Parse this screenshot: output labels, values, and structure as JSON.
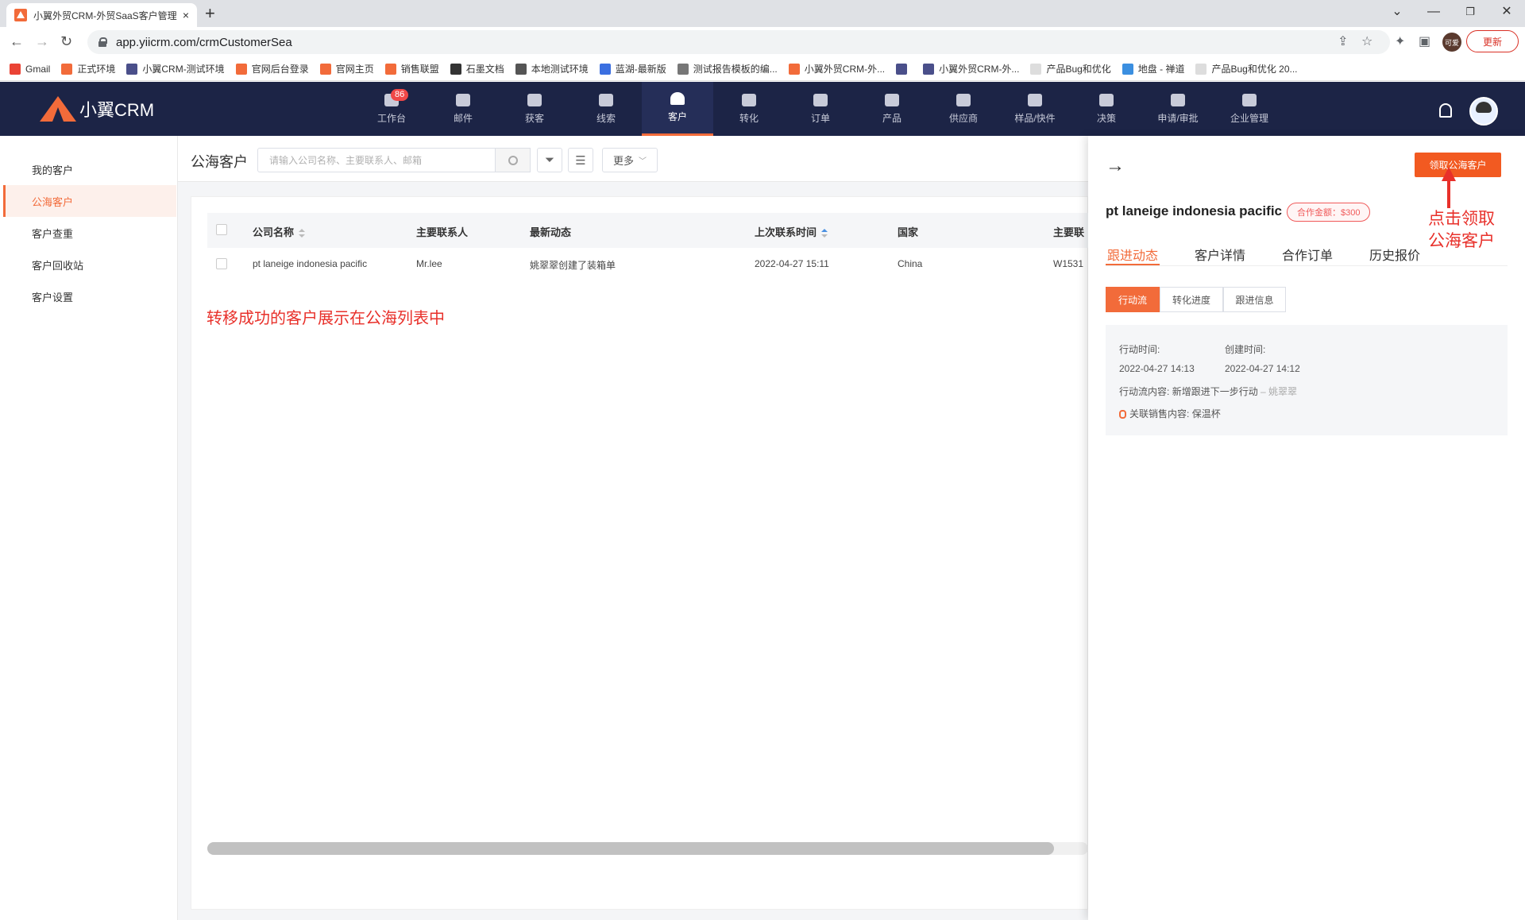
{
  "browser": {
    "tab_title": "小翼外贸CRM-外贸SaaS客户管理",
    "url": "app.yiicrm.com/crmCustomerSea",
    "update_label": "更新",
    "profile_label": "可爱",
    "bookmarks": [
      {
        "label": "Gmail",
        "color": "#ea4335"
      },
      {
        "label": "正式环境",
        "color": "#f26b3a"
      },
      {
        "label": "小翼CRM-测试环境",
        "color": "#4a4f8a"
      },
      {
        "label": "官网后台登录",
        "color": "#f26b3a"
      },
      {
        "label": "官网主页",
        "color": "#f26b3a"
      },
      {
        "label": "销售联盟",
        "color": "#f26b3a"
      },
      {
        "label": "石墨文档",
        "color": "#333333"
      },
      {
        "label": "本地测试环境",
        "color": "#555555"
      },
      {
        "label": "蓝湖-最新版",
        "color": "#3b6fe0"
      },
      {
        "label": "测试报告模板的编...",
        "color": "#777777"
      },
      {
        "label": "小翼外贸CRM-外...",
        "color": "#f26b3a"
      },
      {
        "label": "",
        "color": "#4a4f8a"
      },
      {
        "label": "小翼外贸CRM-外...",
        "color": "#4a4f8a"
      },
      {
        "label": "产品Bug和优化",
        "color": "#dddddd"
      },
      {
        "label": "地盘 - 禅道",
        "color": "#3b8fe0"
      },
      {
        "label": "产品Bug和优化 20...",
        "color": "#dddddd"
      }
    ]
  },
  "app": {
    "logo_text": "小翼CRM",
    "badge_count": "86",
    "nav": [
      {
        "label": "工作台",
        "icon": "workbench-icon"
      },
      {
        "label": "邮件",
        "icon": "mail-icon"
      },
      {
        "label": "获客",
        "icon": "acquire-icon"
      },
      {
        "label": "线索",
        "icon": "leads-icon"
      },
      {
        "label": "客户",
        "icon": "customer-icon"
      },
      {
        "label": "转化",
        "icon": "funnel-icon"
      },
      {
        "label": "订单",
        "icon": "order-icon"
      },
      {
        "label": "产品",
        "icon": "product-icon"
      },
      {
        "label": "供应商",
        "icon": "supplier-icon"
      },
      {
        "label": "样品/快件",
        "icon": "sample-icon"
      },
      {
        "label": "决策",
        "icon": "decision-icon"
      },
      {
        "label": "申请/审批",
        "icon": "approval-icon"
      },
      {
        "label": "企业管理",
        "icon": "enterprise-icon"
      }
    ],
    "active_nav": "客户"
  },
  "sidebar": {
    "items": [
      {
        "label": "我的客户"
      },
      {
        "label": "公海客户"
      },
      {
        "label": "客户查重"
      },
      {
        "label": "客户回收站"
      },
      {
        "label": "客户设置"
      }
    ],
    "active": "公海客户"
  },
  "main": {
    "title": "公海客户",
    "search_placeholder": "请输入公司名称、主要联系人、邮箱",
    "more_label": "更多",
    "columns": [
      "公司名称",
      "主要联系人",
      "最新动态",
      "上次联系时间",
      "国家",
      "主要联"
    ],
    "rows": [
      [
        "pt laneige indonesia pacific",
        "Mr.lee",
        "姚翠翠创建了装箱单",
        "2022-04-27 15:11",
        "China",
        "W1531"
      ]
    ],
    "note": "转移成功的客户展示在公海列表中"
  },
  "panel": {
    "claim_button": "领取公海客户",
    "customer_name": "pt laneige indonesia pacific",
    "coop_badge": "合作金额：$300",
    "annotation_line1": "点击领取",
    "annotation_line2": "公海客户",
    "tabs": [
      "跟进动态",
      "客户详情",
      "合作订单",
      "历史报价"
    ],
    "segments": [
      "行动流",
      "转化进度",
      "跟进信息"
    ],
    "activity": {
      "action_time_label": "行动时间:",
      "action_time": "2022-04-27 14:13",
      "created_time_label": "创建时间:",
      "created_time": "2022-04-27 14:12",
      "content_label": "行动流内容:",
      "content": "新增跟进下一步行动",
      "author": "– 姚翠翠",
      "related_label": "关联销售内容:",
      "related": "保温杯"
    }
  },
  "colors": {
    "accent": "#f26b3a",
    "header_bg": "#1c2446",
    "annotation_red": "#e8302a"
  }
}
